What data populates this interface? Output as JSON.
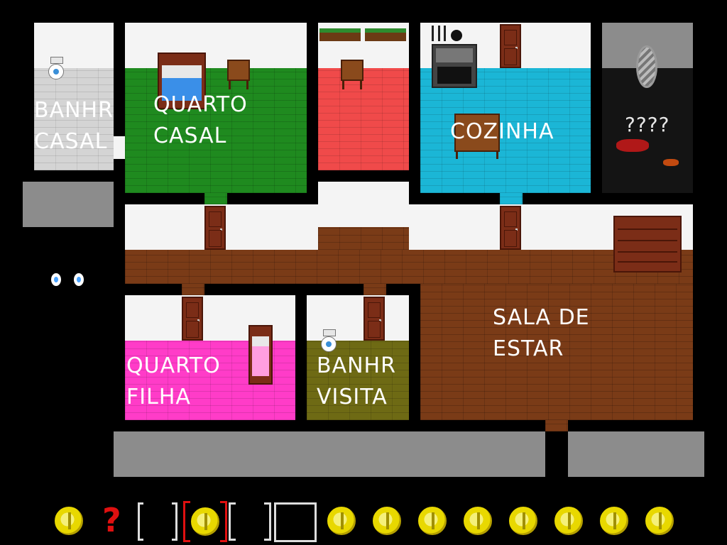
{
  "rooms": {
    "banhr_casal": "BANHR\nCASAL",
    "quarto_casal": "QUARTO\nCASAL",
    "cozinha": "COZINHA",
    "unknown": "????",
    "sala_de_estar": "SALA DE\nESTAR",
    "quarto_filha": "QUARTO\nFILHA",
    "banhr_visita": "BANHR\nVISITA"
  },
  "inventory": {
    "slots": [
      {
        "icon": "coin-icon",
        "selected": false
      },
      {
        "icon": "question-mark-icon",
        "text": "?",
        "selected": false
      },
      {
        "icon": "empty-slot",
        "selected": false
      },
      {
        "icon": "coin-icon",
        "selected": true
      },
      {
        "icon": "empty-slot",
        "selected": false
      },
      {
        "icon": "empty-box-slot",
        "selected": false
      },
      {
        "icon": "coin-icon"
      },
      {
        "icon": "coin-icon"
      },
      {
        "icon": "coin-icon"
      },
      {
        "icon": "coin-icon"
      },
      {
        "icon": "coin-icon"
      },
      {
        "icon": "coin-icon"
      },
      {
        "icon": "coin-icon"
      },
      {
        "icon": "coin-icon"
      }
    ]
  },
  "colors": {
    "green_room": "#1f8a1f",
    "red_room": "#f04a4a",
    "cyan_room": "#1bb6d6",
    "brown_floor": "#7a3b17",
    "pink_room": "#ff3cc8",
    "olive_room": "#6e6a14",
    "selection_red": "#e01010"
  }
}
